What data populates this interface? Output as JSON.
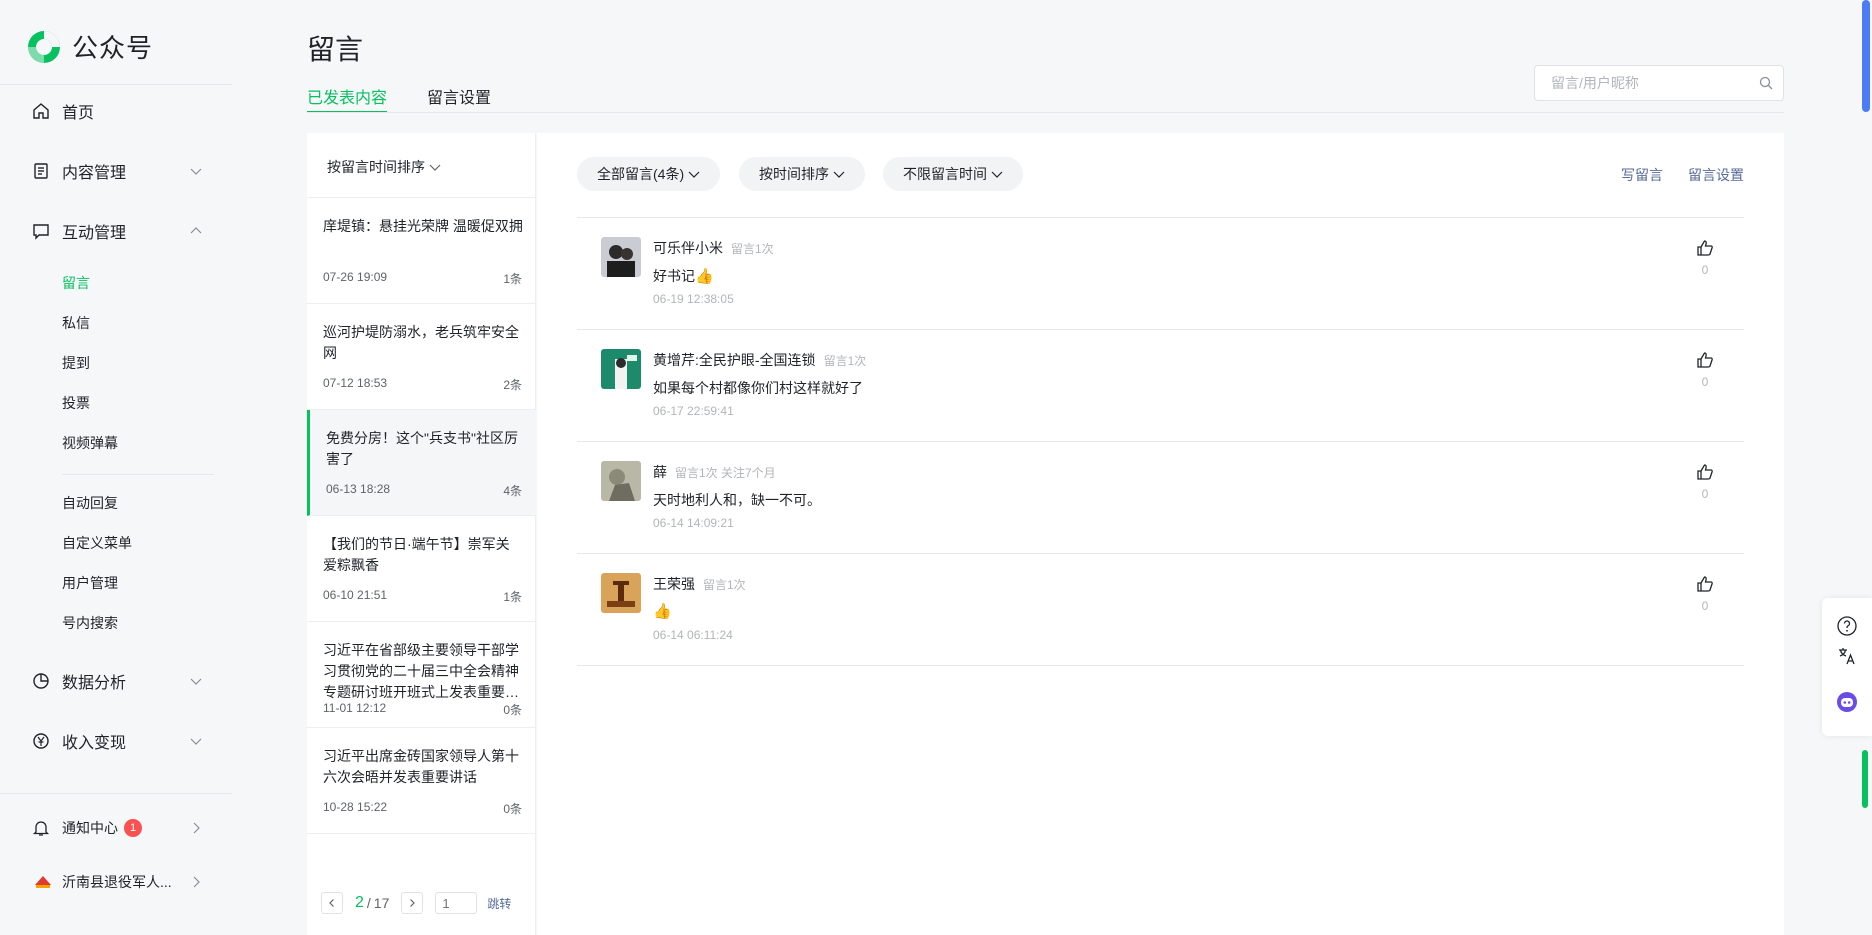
{
  "brand": {
    "name": "公众号",
    "accent": "#07c160"
  },
  "sidebar": {
    "home": "首页",
    "content_mgmt": "内容管理",
    "interaction_mgmt": "互动管理",
    "sub_items": [
      "留言",
      "私信",
      "提到",
      "投票",
      "视频弹幕"
    ],
    "sub_items2": [
      "自动回复",
      "自定义菜单",
      "用户管理",
      "号内搜索"
    ],
    "data_analysis": "数据分析",
    "income": "收入变现",
    "notify": "通知中心",
    "notify_count": "1",
    "account": "沂南县退役军人..."
  },
  "header": {
    "title": "留言",
    "tabs": [
      "已发表内容",
      "留言设置"
    ],
    "search_placeholder": "留言/用户昵称"
  },
  "list": {
    "sort_label": "按留言时间排序",
    "posts": [
      {
        "title": "庠堤镇：悬挂光荣牌 温暖促双拥",
        "date": "07-26 19:09",
        "count": "1条"
      },
      {
        "title": "巡河护堤防溺水，老兵筑牢安全网",
        "date": "07-12 18:53",
        "count": "2条"
      },
      {
        "title": "免费分房！这个\"兵支书\"社区厉害了",
        "date": "06-13 18:28",
        "count": "4条"
      },
      {
        "title": "【我们的节日·端午节】崇军关爱粽飘香",
        "date": "06-10 21:51",
        "count": "1条"
      },
      {
        "title": "习近平在省部级主要领导干部学习贯彻党的二十届三中全会精神专题研讨班开班式上发表重要讲话",
        "date": "11-01 12:12",
        "count": "0条"
      },
      {
        "title": "习近平出席金砖国家领导人第十六次会晤并发表重要讲话",
        "date": "10-28 15:22",
        "count": "0条"
      }
    ],
    "pager": {
      "current": "2",
      "sep": "/",
      "total": "17",
      "input_placeholder": "1",
      "jump": "跳转"
    }
  },
  "comments": {
    "filters": [
      "全部留言(4条)",
      "按时间排序",
      "不限留言时间"
    ],
    "write": "写留言",
    "settings": "留言设置",
    "items": [
      {
        "name": "可乐伴小米",
        "meta": "留言1次",
        "text": "好书记",
        "emoji": "👍",
        "time": "06-19 12:38:05",
        "likes": "0"
      },
      {
        "name": "黄增芹:全民护眼-全国连锁",
        "meta": "留言1次",
        "text": "如果每个村都像你们村这样就好了",
        "emoji": "",
        "time": "06-17 22:59:41",
        "likes": "0"
      },
      {
        "name": "薛",
        "meta": "留言1次 关注7个月",
        "text": "天时地利人和，缺一不可。",
        "emoji": "",
        "time": "06-14 14:09:21",
        "likes": "0"
      },
      {
        "name": "王荣强",
        "meta": "留言1次",
        "text": "",
        "emoji": "👍",
        "time": "06-14 06:11:24",
        "likes": "0"
      }
    ]
  }
}
